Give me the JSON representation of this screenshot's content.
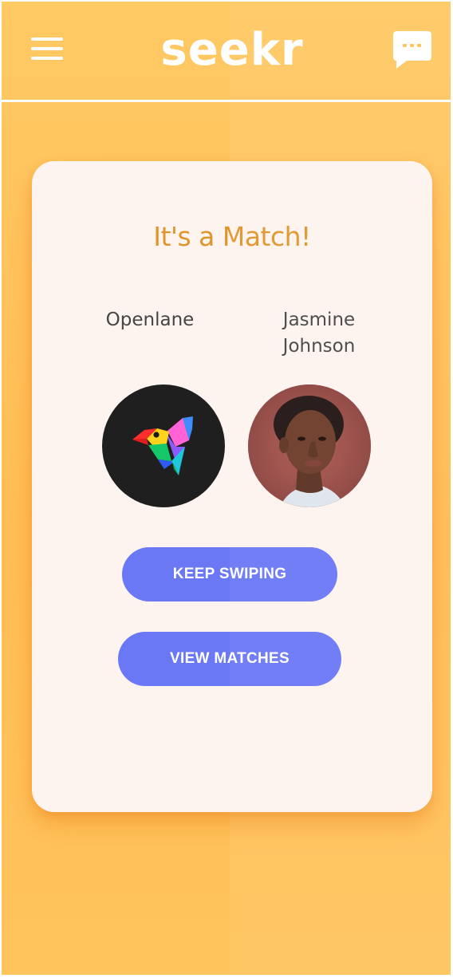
{
  "app": {
    "logo_text": "seekr",
    "brand_color": "#ffc35e",
    "accent_color": "#6a78f5"
  },
  "header": {
    "menu_icon": "hamburger-menu-icon",
    "chat_icon": "chat-bubble-icon"
  },
  "match_card": {
    "title": "It's a Match!",
    "left_profile": {
      "name": "Openlane",
      "avatar": "openlane-bird-logo"
    },
    "right_profile": {
      "name_line1": "Jasmine",
      "name_line2": "Johnson",
      "avatar": "profile-photo"
    },
    "keep_swiping_label": "KEEP SWIPING",
    "view_matches_label": "VIEW MATCHES"
  }
}
